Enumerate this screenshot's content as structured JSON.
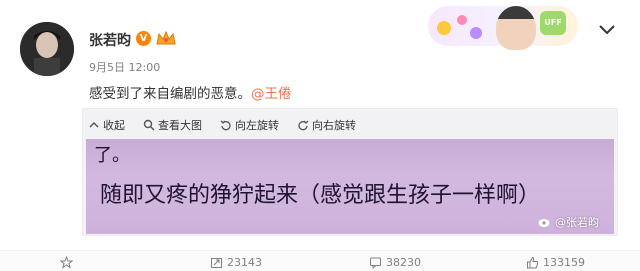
{
  "post": {
    "author": "张若昀",
    "verified_badge": "V",
    "meta": "9月5日 12:00",
    "text_prefix": "感受到了来自编剧的恶意。",
    "mention": "@王倦"
  },
  "header": {
    "fan_tag": "UFF"
  },
  "media_toolbar": {
    "collapse": "收起",
    "view_large": "查看大图",
    "rotate_left": "向左旋转",
    "rotate_right": "向右旋转"
  },
  "photo": {
    "line1": "了。",
    "line2": "随即又疼的狰狞起来（感觉跟生孩子一样啊）",
    "watermark": "@张若昀"
  },
  "actions": {
    "repost_count": "23143",
    "comment_count": "38230",
    "like_count": "133159"
  },
  "colors": {
    "mention": "#eb7350",
    "badge": "#ff8200",
    "photo_bg": "#cbb0d9"
  }
}
